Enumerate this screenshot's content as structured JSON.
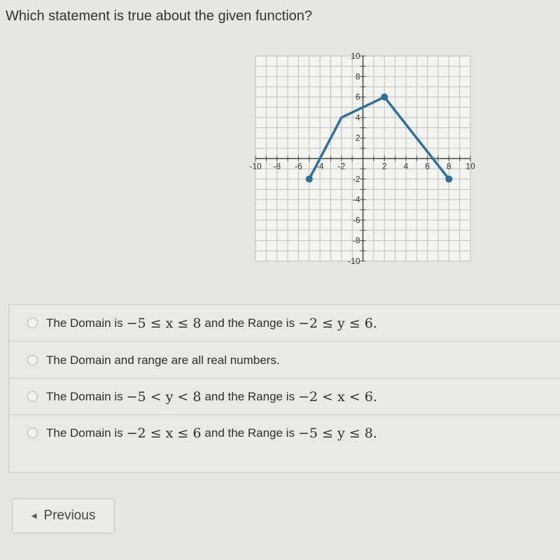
{
  "question": "Which statement is true about the given function?",
  "chart_data": {
    "type": "line",
    "xlim": [
      -10,
      10
    ],
    "ylim": [
      -10,
      10
    ],
    "x_ticks": [
      "-10",
      "-8",
      "-6",
      "-4",
      "-2",
      "2",
      "4",
      "6",
      "8",
      "10"
    ],
    "y_ticks": [
      "10",
      "8",
      "6",
      "4",
      "2",
      "-2",
      "-4",
      "-6",
      "-8",
      "-10"
    ],
    "grid": true,
    "points": [
      {
        "x": -5,
        "y": -2
      },
      {
        "x": -2,
        "y": 4
      },
      {
        "x": 2,
        "y": 6
      },
      {
        "x": 8,
        "y": -2
      }
    ],
    "marked_points": [
      {
        "x": -5,
        "y": -2
      },
      {
        "x": 2,
        "y": 6
      },
      {
        "x": 8,
        "y": -2
      }
    ],
    "line_color": "#2f6f99"
  },
  "options": [
    {
      "pre": "The Domain is",
      "m1": "−5 ≤ x ≤ 8",
      "mid": "and the Range is",
      "m2": "−2 ≤ y ≤ 6."
    },
    {
      "pre": "The Domain and range are all real numbers.",
      "m1": "",
      "mid": "",
      "m2": ""
    },
    {
      "pre": "The Domain is",
      "m1": "−5 < y < 8",
      "mid": "and the Range is",
      "m2": "−2 < x < 6."
    },
    {
      "pre": "The Domain is",
      "m1": "−2 ≤ x ≤ 6",
      "mid": "and the Range is",
      "m2": "−5 ≤ y ≤ 8."
    }
  ],
  "previous_label": "Previous",
  "previous_icon": "triangle-left-icon"
}
